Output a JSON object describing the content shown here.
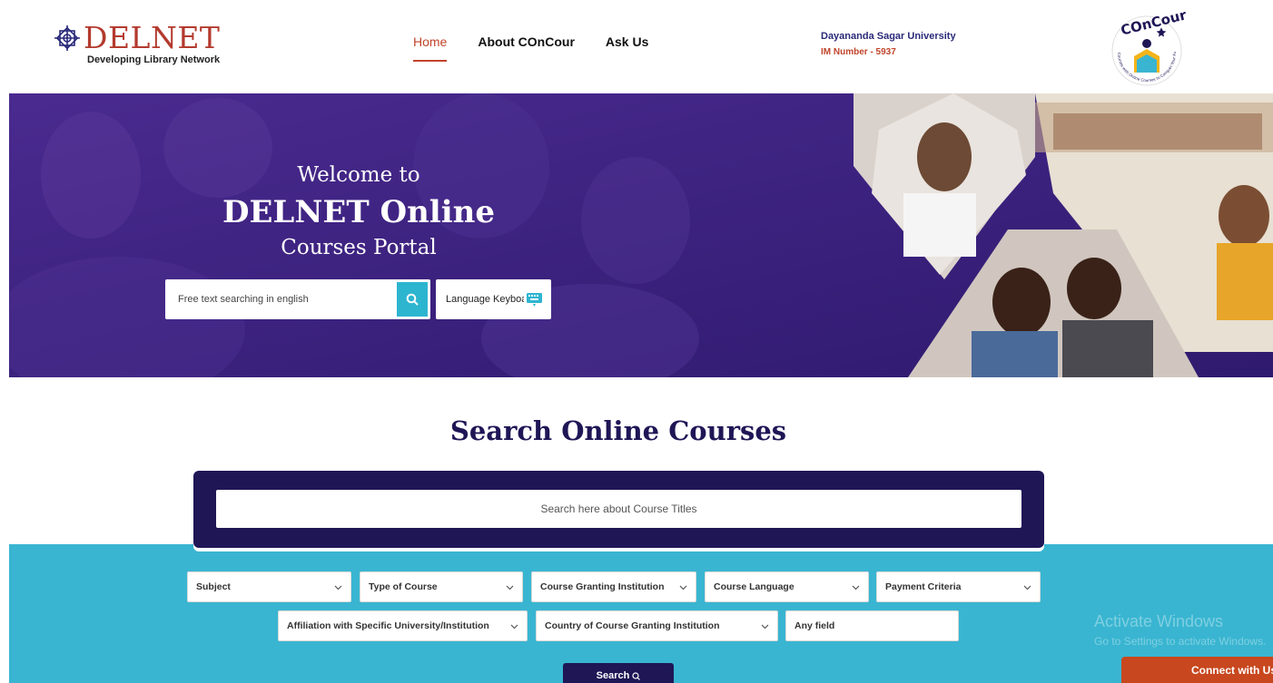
{
  "header": {
    "logo_text": "DELNET",
    "logo_tagline": "Developing Library Network",
    "nav": [
      {
        "label": "Home",
        "active": true
      },
      {
        "label": "About COnCour",
        "active": false
      },
      {
        "label": "Ask Us",
        "active": false
      }
    ],
    "institution": {
      "name": "Dayananda Sagar University",
      "im_number": "IM Number - 5937"
    },
    "concour_logo_text": "COnCour",
    "concour_logo_ring": "Courses with Online Courses to Conquer Your Future Now"
  },
  "hero": {
    "welcome": "Welcome to",
    "title": "DELNET Online",
    "subtitle": "Courses Portal",
    "search_placeholder": "Free text searching in english",
    "language_keyboard": "Language Keyboard"
  },
  "search_section": {
    "title": "Search Online Courses",
    "course_search_placeholder": "Search here about Course Titles",
    "filters_row1": [
      "Subject",
      "Type of Course",
      "Course Granting Institution",
      "Course Language",
      "Payment Criteria"
    ],
    "filters_row2": [
      "Affiliation with Specific University/Institution",
      "Country of  Course Granting Institution"
    ],
    "any_field": "Any field",
    "search_button": "Search"
  },
  "overlay": {
    "activate_title": "Activate Windows",
    "activate_sub": "Go to Settings to activate Windows.",
    "connect": "Connect with Us"
  },
  "colors": {
    "brand_red": "#c0442b",
    "navy": "#1f1656",
    "hero_purple": "#3d2382",
    "cyan": "#39b5d1",
    "connect_orange": "#c8471e"
  }
}
